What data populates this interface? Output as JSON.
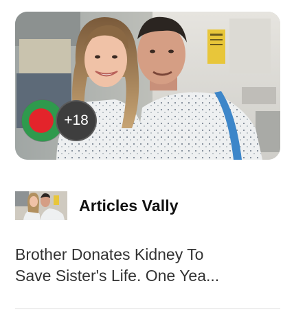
{
  "hero": {
    "badge_icon": "bangladesh-flag-icon",
    "reaction_count": "+18",
    "flag_colors": {
      "field": "#2f9a4d",
      "disc": "#e3242b"
    }
  },
  "source": {
    "name": "Articles Vally",
    "thumbnail_icon": "source-avatar-photo"
  },
  "article": {
    "title_line_1": "Brother Donates Kidney To",
    "title_line_2": "Save Sister's Life. One Yea..."
  }
}
